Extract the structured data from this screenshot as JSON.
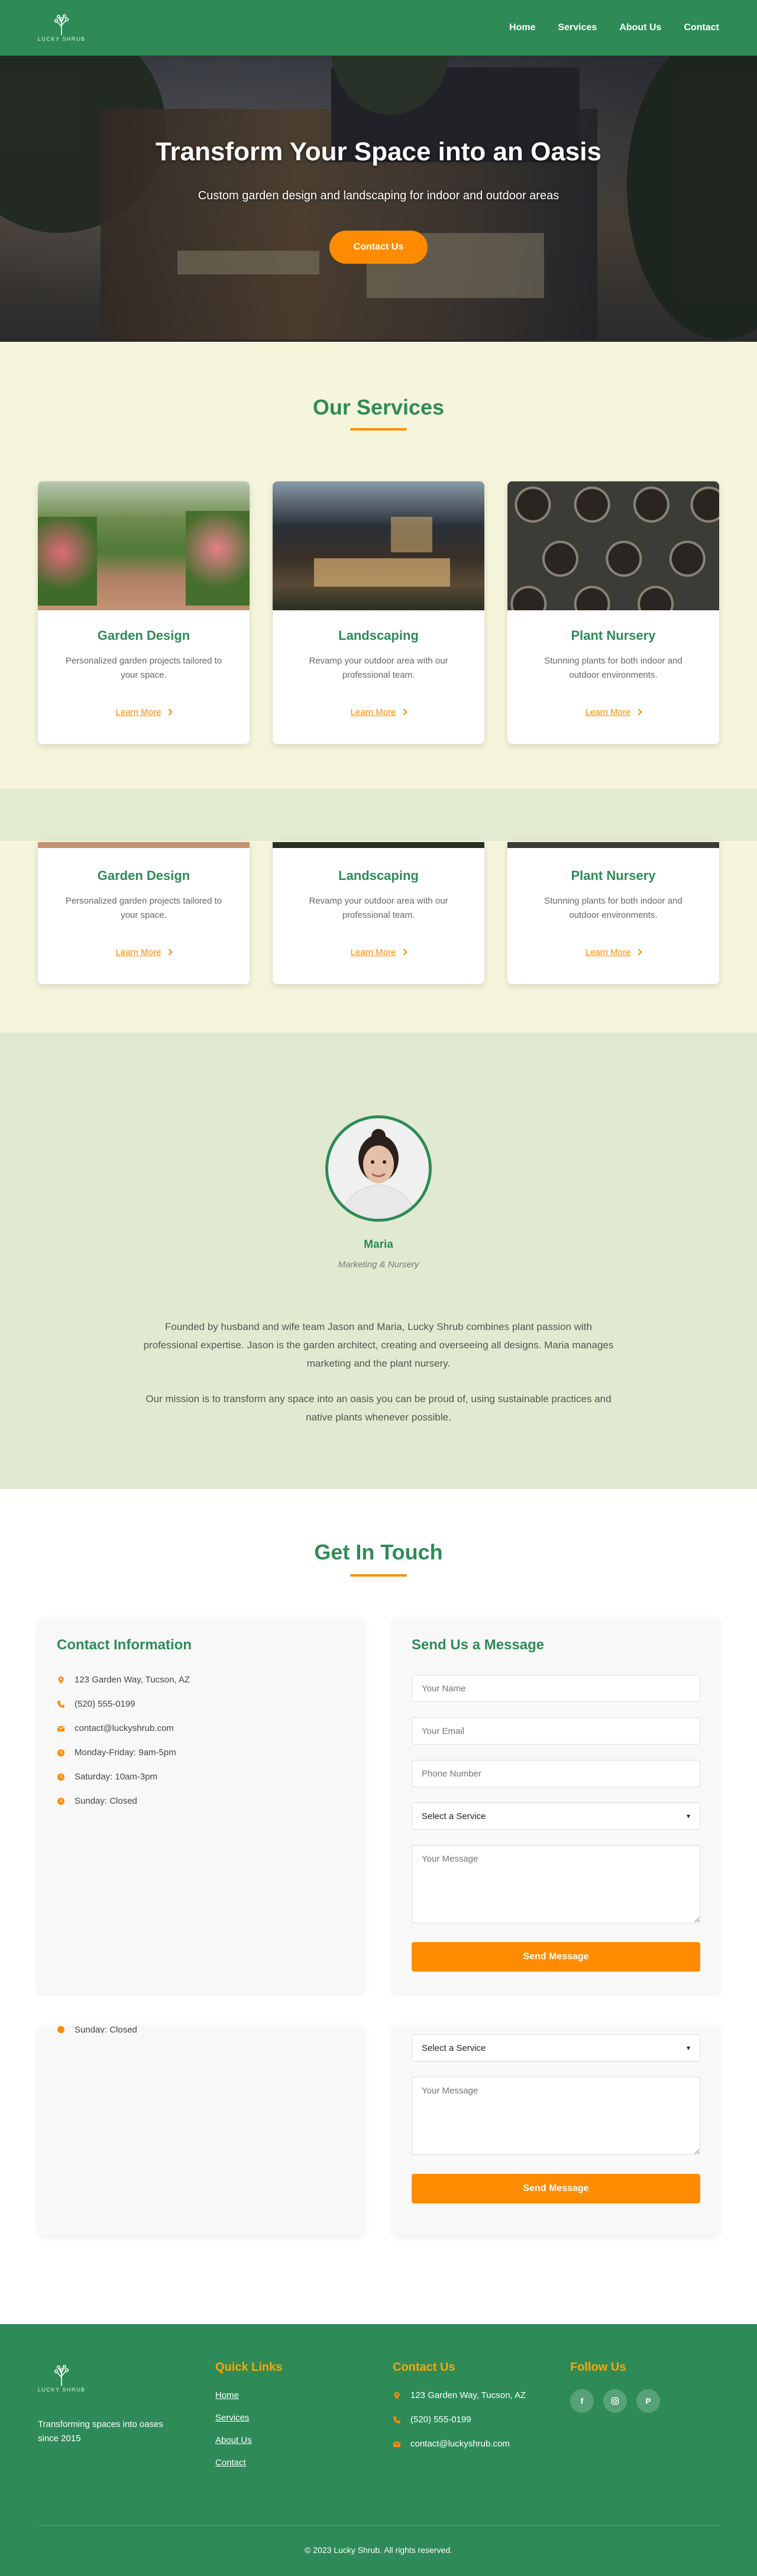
{
  "brand": {
    "logo_text": "LUCKY SHRUB",
    "logo_icon": "tree-icon"
  },
  "nav": {
    "links": [
      "Home",
      "Services",
      "About Us",
      "Contact"
    ]
  },
  "hero": {
    "title": "Transform Your Space into an Oasis",
    "subtitle": "Custom garden design and landscaping for indoor and outdoor areas",
    "cta": "Contact Us"
  },
  "services": {
    "title": "Our Services",
    "cards": [
      {
        "title": "Garden Design",
        "text": "Personalized garden projects tailored to your space.",
        "link": "Learn More"
      },
      {
        "title": "Landscaping",
        "text": "Revamp your outdoor area with our professional team.",
        "link": "Learn More"
      },
      {
        "title": "Plant Nursery",
        "text": "Stunning plants for both indoor and outdoor environments.",
        "link": "Learn More"
      }
    ]
  },
  "about": {
    "name": "Maria",
    "role": "Marketing & Nursery",
    "para1": "Founded by husband and wife team Jason and Maria, Lucky Shrub combines plant passion with professional expertise. Jason is the garden architect, creating and overseeing all designs. Maria manages marketing and the plant nursery.",
    "para2": "Our mission is to transform any space into an oasis you can be proud of, using sustainable practices and native plants whenever possible."
  },
  "contact": {
    "title": "Get In Touch",
    "info_title": "Contact Information",
    "info": [
      {
        "icon": "map-pin-icon",
        "text": "123 Garden Way, Tucson, AZ"
      },
      {
        "icon": "phone-icon",
        "text": "(520) 555-0199"
      },
      {
        "icon": "envelope-icon",
        "text": "contact@luckyshrub.com"
      },
      {
        "icon": "clock-icon",
        "text": "Monday-Friday: 9am-5pm"
      },
      {
        "icon": "clock-icon",
        "text": "Saturday: 10am-3pm"
      },
      {
        "icon": "clock-icon",
        "text": "Sunday: Closed"
      }
    ],
    "form_title": "Send Us a Message",
    "name_placeholder": "Your Name",
    "email_placeholder": "Your Email",
    "phone_placeholder": "Phone Number",
    "select_value": "Select a Service",
    "message_placeholder": "Your Message",
    "submit": "Send Message"
  },
  "footer": {
    "tagline": "Transforming spaces into oases since 2015",
    "quick_links_title": "Quick Links",
    "quick_links": [
      "Home",
      "Services",
      "About Us",
      "Contact"
    ],
    "contact_title": "Contact Us",
    "contact_items": [
      {
        "icon": "map-pin-icon",
        "text": "123 Garden Way, Tucson, AZ"
      },
      {
        "icon": "phone-icon",
        "text": "(520) 555-0199"
      },
      {
        "icon": "envelope-icon",
        "text": "contact@luckyshrub.com"
      }
    ],
    "follow_title": "Follow Us",
    "social_icons": [
      "facebook-icon",
      "instagram-icon",
      "pinterest-icon"
    ],
    "copyright": "© 2023 Lucky Shrub. All rights reserved."
  },
  "colors": {
    "primary": "#2e8b57",
    "accent": "#ff8c00",
    "cream": "#f5f5dc",
    "sage": "#e1ead0"
  }
}
